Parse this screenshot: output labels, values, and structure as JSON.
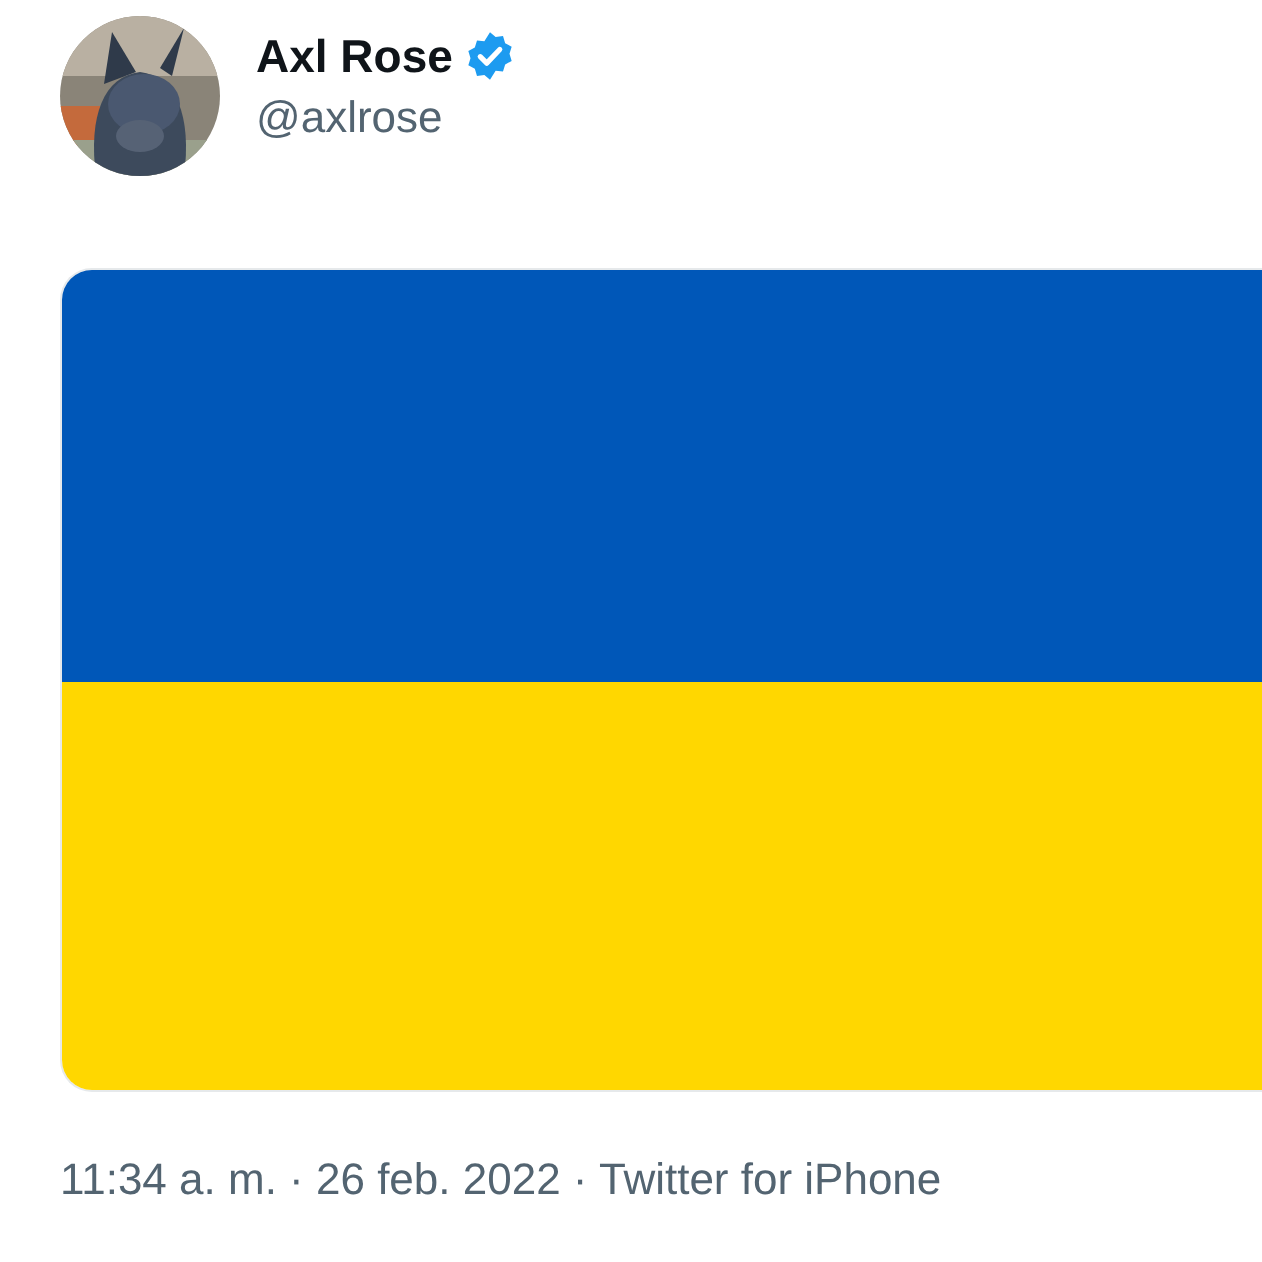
{
  "author": {
    "name": "Axl Rose",
    "verified": true,
    "handle": "@axlrose"
  },
  "meta": "11:34 a. m. · 26 feb. 2022 · Twitter for iPhone"
}
